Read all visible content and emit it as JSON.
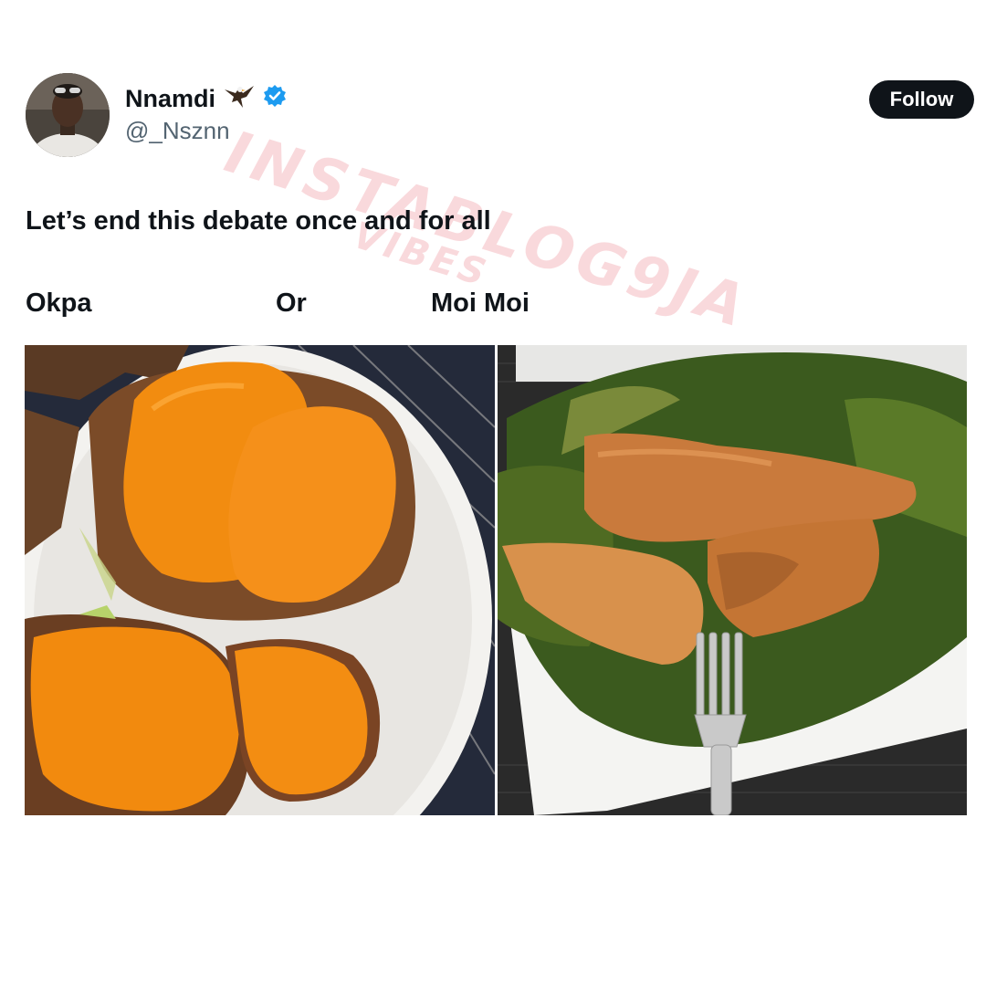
{
  "user": {
    "display_name": "Nnamdi",
    "handle": "@_Nsznn",
    "verified": true,
    "name_emoji_icon": "eagle-emoji-icon",
    "verified_badge_icon": "verified-badge-icon"
  },
  "follow_label": "Follow",
  "tweet": {
    "text": "Let’s end this debate once and for all",
    "option_a": "Okpa",
    "separator": "Or",
    "option_b": "Moi Moi"
  },
  "watermark": {
    "line1": "INSTABLOG9JA",
    "line2": "VIBES"
  },
  "colors": {
    "follow_bg": "#0f1419",
    "verified_blue": "#1d9bf0",
    "okpa_orange": "#f08a12",
    "moimoi_tan": "#c9773a",
    "leaf_green": "#3b5a1e"
  }
}
